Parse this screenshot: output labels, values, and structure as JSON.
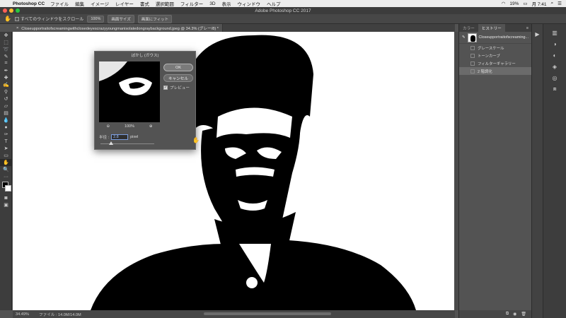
{
  "menubar": {
    "app_name": "Photoshop CC",
    "items": [
      "ファイル",
      "編集",
      "イメージ",
      "レイヤー",
      "書式",
      "選択範囲",
      "フィルター",
      "3D",
      "表示",
      "ウィンドウ",
      "ヘルプ"
    ],
    "battery": "19%",
    "clock": "月 7:41"
  },
  "window": {
    "title": "Adobe Photoshop CC 2017"
  },
  "options": {
    "scroll_all_label": "すべてのウィンドウをスクロール",
    "zoom_value": "100%",
    "fit_screen_label": "画面サイズ",
    "fill_screen_label": "画面にフィット"
  },
  "document": {
    "tab_title": "Closeupportraitofscreamingwithclosedeyescrazyyoungmanisolatedongraybackground.jpeg @ 34.3% (グレー/8) *",
    "zoom_status": "34.49%",
    "file_status": "ファイル : 14.0M/14.0M"
  },
  "panel": {
    "tabs": [
      "カラー",
      "ヒストリー"
    ],
    "snapshot_name": "Closeupportraitofscreaming...",
    "history": [
      "グレースケール",
      "トーンカーブ",
      "フィルターギャラリー",
      "2 階調化"
    ]
  },
  "dialog": {
    "title": "ぼかし (ガウス)",
    "ok_label": "OK",
    "cancel_label": "キャンセル",
    "preview_label": "プレビュー",
    "preview_checked": true,
    "zoom_pct": "100%",
    "radius_label": "半径 :",
    "radius_value": "2.8",
    "radius_unit": "pixel",
    "zoom_out_icon": "minus-magnifier-icon",
    "zoom_in_icon": "plus-magnifier-icon"
  },
  "colors": {
    "accent": "#7b9ee0",
    "canvas": "#ffffff",
    "ui_dark": "#535353"
  }
}
